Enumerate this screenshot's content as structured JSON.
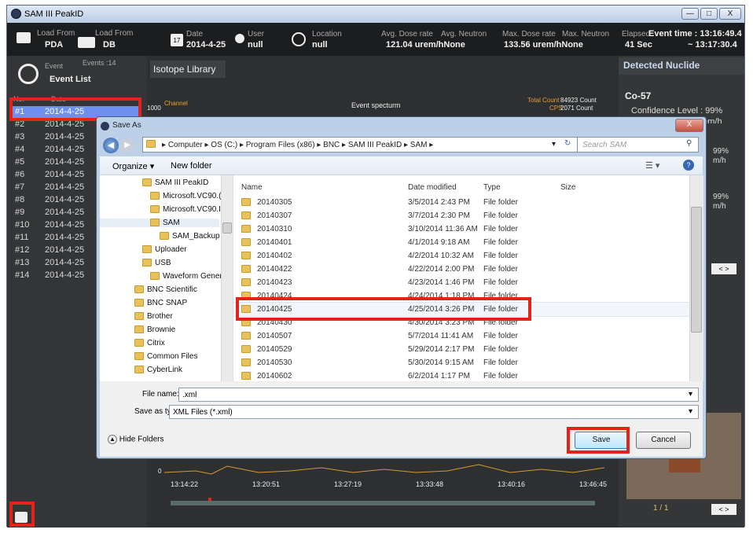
{
  "window": {
    "title": "SAM III PeakID",
    "min": "—",
    "max": "□",
    "close": "X"
  },
  "top": {
    "load_pda_label": "Load From",
    "load_pda_value": "PDA",
    "load_db_label": "Load From",
    "load_db_value": "DB",
    "date_label": "Date",
    "date_day": "17",
    "date_value": "2014-4-25",
    "user_label": "User",
    "user_value": "null",
    "location_label": "Location",
    "location_value": "null",
    "avg_dose_label": "Avg. Dose rate",
    "avg_neutron_label": "Avg. Neutron",
    "avg_value": "121.04 urem/hNone",
    "max_dose_label": "Max. Dose rate",
    "max_neutron_label": "Max. Neutron",
    "max_value": "133.56 urem/hNone",
    "elapsed_label": "Elapsed",
    "elapsed_value": "41 Sec",
    "event_time_label": "Event time : 13:16:49.4",
    "event_time_end": "~ 13:17:30.4"
  },
  "left": {
    "event_label": "Event",
    "events_count": "Events :14",
    "event_list": "Event List",
    "col_no": "No.",
    "col_date": "Date",
    "events": [
      {
        "no": "#1",
        "date": "2014-4-25"
      },
      {
        "no": "#2",
        "date": "2014-4-25"
      },
      {
        "no": "#3",
        "date": "2014-4-25"
      },
      {
        "no": "#4",
        "date": "2014-4-25"
      },
      {
        "no": "#5",
        "date": "2014-4-25"
      },
      {
        "no": "#6",
        "date": "2014-4-25"
      },
      {
        "no": "#7",
        "date": "2014-4-25"
      },
      {
        "no": "#8",
        "date": "2014-4-25"
      },
      {
        "no": "#9",
        "date": "2014-4-25"
      },
      {
        "no": "#10",
        "date": "2014-4-25"
      },
      {
        "no": "#11",
        "date": "2014-4-25"
      },
      {
        "no": "#12",
        "date": "2014-4-25"
      },
      {
        "no": "#13",
        "date": "2014-4-25"
      },
      {
        "no": "#14",
        "date": "2014-4-25"
      }
    ]
  },
  "center": {
    "tab": "Isotope Library",
    "spectrum_y": "1000",
    "channel": "Channel",
    "spectrum_title": "Event specturm",
    "total_count_label": "Total Count",
    "total_count": "84923 Count",
    "cps_label": "CPS",
    "cps": "2071 Count",
    "timeline_zero": "0",
    "times": [
      "13:14:22",
      "13:20:51",
      "13:27:19",
      "13:33:48",
      "13:40:16",
      "13:46:45"
    ]
  },
  "right": {
    "detected": "Detected Nuclide",
    "nuclide": "Co-57",
    "confidence": "Confidence Level : 99%",
    "dose_rate": "Dose rate : 1.01 urem/h",
    "pct1": "99%",
    "unit1": "m/h",
    "pct2": "99%",
    "unit2": "m/h",
    "page": "1 / 1"
  },
  "dialog": {
    "title": "Save As",
    "path": [
      "Computer",
      "OS (C:)",
      "Program Files (x86)",
      "BNC",
      "SAM III PeakID",
      "SAM"
    ],
    "search_placeholder": "Search SAM",
    "organize": "Organize ▾",
    "new_folder": "New folder",
    "tree": [
      "SAM III PeakID",
      "Microsoft.VC90.(",
      "Microsoft.VC90.I",
      "SAM",
      "SAM_Backup",
      "Uploader",
      "USB",
      "Waveform Genera",
      "BNC Scientific",
      "BNC SNAP",
      "Brother",
      "Brownie",
      "Citrix",
      "Common Files",
      "CyberLink"
    ],
    "columns": {
      "name": "Name",
      "date": "Date modified",
      "type": "Type",
      "size": "Size"
    },
    "rows": [
      {
        "name": "20140305",
        "date": "3/5/2014 2:43 PM",
        "type": "File folder"
      },
      {
        "name": "20140307",
        "date": "3/7/2014 2:30 PM",
        "type": "File folder"
      },
      {
        "name": "20140310",
        "date": "3/10/2014 11:36 AM",
        "type": "File folder"
      },
      {
        "name": "20140401",
        "date": "4/1/2014 9:18 AM",
        "type": "File folder"
      },
      {
        "name": "20140402",
        "date": "4/2/2014 10:32 AM",
        "type": "File folder"
      },
      {
        "name": "20140422",
        "date": "4/22/2014 2:00 PM",
        "type": "File folder"
      },
      {
        "name": "20140423",
        "date": "4/23/2014 1:46 PM",
        "type": "File folder"
      },
      {
        "name": "20140424",
        "date": "4/24/2014 1:18 PM",
        "type": "File folder"
      },
      {
        "name": "20140425",
        "date": "4/25/2014 3:26 PM",
        "type": "File folder"
      },
      {
        "name": "20140430",
        "date": "4/30/2014 3:23 PM",
        "type": "File folder"
      },
      {
        "name": "20140507",
        "date": "5/7/2014 11:41 AM",
        "type": "File folder"
      },
      {
        "name": "20140529",
        "date": "5/29/2014 2:17 PM",
        "type": "File folder"
      },
      {
        "name": "20140530",
        "date": "5/30/2014 9:15 AM",
        "type": "File folder"
      },
      {
        "name": "20140602",
        "date": "6/2/2014 1:17 PM",
        "type": "File folder"
      }
    ],
    "file_name_label": "File name:",
    "file_name": ".xml",
    "save_type_label": "Save as type:",
    "save_type": "XML Files (*.xml)",
    "hide_folders": "Hide Folders",
    "save": "Save",
    "cancel": "Cancel"
  },
  "colors": {
    "selection": "#6d8ff0",
    "highlight": "#e2231a",
    "dialog_frame": "#bcd0e7"
  }
}
